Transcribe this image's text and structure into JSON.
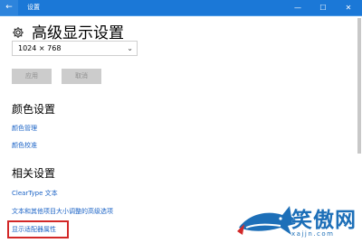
{
  "window": {
    "title": "设置",
    "back_icon": "back-arrow-icon",
    "controls": {
      "minimize": "—",
      "maximize": "☐",
      "close": "✕"
    }
  },
  "header": {
    "icon": "gear-icon",
    "title": "高级显示设置"
  },
  "resolution": {
    "selected": "1024 × 768"
  },
  "buttons": {
    "apply": "应用",
    "cancel": "取消"
  },
  "color_section": {
    "title": "颜色设置",
    "links": [
      "颜色管理",
      "颜色校准"
    ]
  },
  "related_section": {
    "title": "相关设置",
    "links": [
      "ClearType 文本",
      "文本和其他项目大小调整的高级选项",
      "显示适配器属性"
    ]
  },
  "watermark": {
    "text": "笑傲网",
    "url": "xajjn.com"
  }
}
